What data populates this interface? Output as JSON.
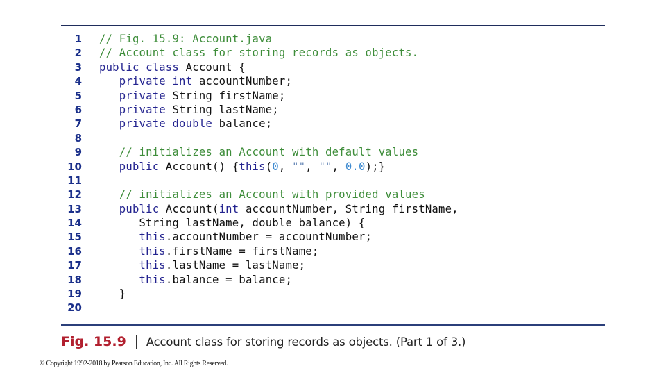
{
  "figure": {
    "label": "Fig. 15.9",
    "caption": "Account class for storing records as objects. (Part 1 of 3.)"
  },
  "code": {
    "language": "java",
    "lines": [
      {
        "number": "1",
        "tokens": [
          {
            "t": "// Fig. 15.9: Account.java",
            "k": "comment"
          }
        ]
      },
      {
        "number": "2",
        "tokens": [
          {
            "t": "// Account class for storing records as objects.",
            "k": "comment"
          }
        ]
      },
      {
        "number": "3",
        "tokens": [
          {
            "t": "public class",
            "k": "keyword"
          },
          {
            "t": " Account {",
            "k": "plain"
          }
        ]
      },
      {
        "number": "4",
        "tokens": [
          {
            "t": "   ",
            "k": "plain"
          },
          {
            "t": "private int",
            "k": "keyword"
          },
          {
            "t": " accountNumber;",
            "k": "plain"
          }
        ]
      },
      {
        "number": "5",
        "tokens": [
          {
            "t": "   ",
            "k": "plain"
          },
          {
            "t": "private",
            "k": "keyword"
          },
          {
            "t": " String firstName;",
            "k": "plain"
          }
        ]
      },
      {
        "number": "6",
        "tokens": [
          {
            "t": "   ",
            "k": "plain"
          },
          {
            "t": "private",
            "k": "keyword"
          },
          {
            "t": " String lastName;",
            "k": "plain"
          }
        ]
      },
      {
        "number": "7",
        "tokens": [
          {
            "t": "   ",
            "k": "plain"
          },
          {
            "t": "private double",
            "k": "keyword"
          },
          {
            "t": " balance;",
            "k": "plain"
          }
        ]
      },
      {
        "number": "8",
        "tokens": []
      },
      {
        "number": "9",
        "tokens": [
          {
            "t": "   ",
            "k": "plain"
          },
          {
            "t": "// initializes an Account with default values",
            "k": "comment"
          }
        ]
      },
      {
        "number": "10",
        "tokens": [
          {
            "t": "   ",
            "k": "plain"
          },
          {
            "t": "public",
            "k": "keyword"
          },
          {
            "t": " Account() {",
            "k": "plain"
          },
          {
            "t": "this",
            "k": "keyword"
          },
          {
            "t": "(",
            "k": "plain"
          },
          {
            "t": "0",
            "k": "number"
          },
          {
            "t": ", ",
            "k": "plain"
          },
          {
            "t": "\"\"",
            "k": "string"
          },
          {
            "t": ", ",
            "k": "plain"
          },
          {
            "t": "\"\"",
            "k": "string"
          },
          {
            "t": ", ",
            "k": "plain"
          },
          {
            "t": "0.0",
            "k": "number"
          },
          {
            "t": ");}",
            "k": "plain"
          }
        ]
      },
      {
        "number": "11",
        "tokens": []
      },
      {
        "number": "12",
        "tokens": [
          {
            "t": "   ",
            "k": "plain"
          },
          {
            "t": "// initializes an Account with provided values",
            "k": "comment"
          }
        ]
      },
      {
        "number": "13",
        "tokens": [
          {
            "t": "   ",
            "k": "plain"
          },
          {
            "t": "public",
            "k": "keyword"
          },
          {
            "t": " Account(",
            "k": "plain"
          },
          {
            "t": "int",
            "k": "keyword"
          },
          {
            "t": " accountNumber, String firstName,",
            "k": "plain"
          }
        ]
      },
      {
        "number": "14",
        "tokens": [
          {
            "t": "      String lastName, double balance) {",
            "k": "plain"
          }
        ]
      },
      {
        "number": "15",
        "tokens": [
          {
            "t": "      ",
            "k": "plain"
          },
          {
            "t": "this",
            "k": "keyword"
          },
          {
            "t": ".accountNumber = accountNumber;",
            "k": "plain"
          }
        ]
      },
      {
        "number": "16",
        "tokens": [
          {
            "t": "      ",
            "k": "plain"
          },
          {
            "t": "this",
            "k": "keyword"
          },
          {
            "t": ".firstName = firstName;",
            "k": "plain"
          }
        ]
      },
      {
        "number": "17",
        "tokens": [
          {
            "t": "      ",
            "k": "plain"
          },
          {
            "t": "this",
            "k": "keyword"
          },
          {
            "t": ".lastName = lastName;",
            "k": "plain"
          }
        ]
      },
      {
        "number": "18",
        "tokens": [
          {
            "t": "      ",
            "k": "plain"
          },
          {
            "t": "this",
            "k": "keyword"
          },
          {
            "t": ".balance = balance;",
            "k": "plain"
          }
        ]
      },
      {
        "number": "19",
        "tokens": [
          {
            "t": "   }",
            "k": "plain"
          }
        ]
      },
      {
        "number": "20",
        "tokens": []
      }
    ]
  },
  "copyright": "© Copyright 1992-2018 by Pearson Education, Inc. All Rights Reserved.",
  "colors": {
    "comment": "#3e8d3a",
    "keyword": "#23238f",
    "number": "#3e8ad0",
    "string": "#6a8ab8",
    "line_number": "#1a2f8a",
    "figure_label": "#b2202f",
    "rule": "#1f2d5c"
  }
}
